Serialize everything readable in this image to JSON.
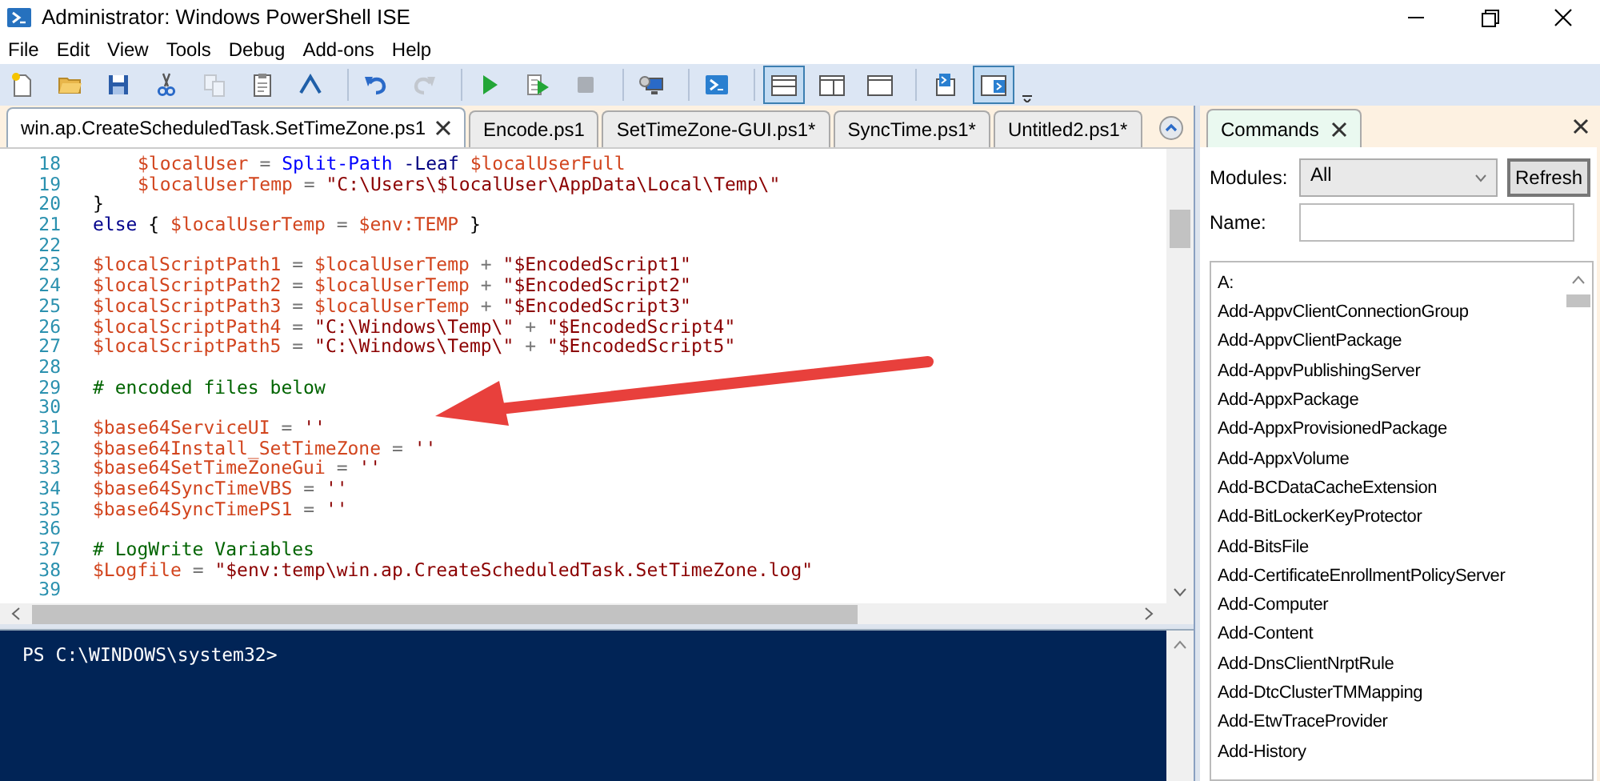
{
  "window": {
    "title": "Administrator: Windows PowerShell ISE"
  },
  "menu": [
    "File",
    "Edit",
    "View",
    "Tools",
    "Debug",
    "Add-ons",
    "Help"
  ],
  "toolbar": [
    {
      "kind": "new",
      "pressed": false,
      "disabled": false
    },
    {
      "kind": "open",
      "pressed": false,
      "disabled": false
    },
    {
      "kind": "save",
      "pressed": false,
      "disabled": false
    },
    {
      "kind": "cut",
      "pressed": false,
      "disabled": false
    },
    {
      "kind": "copy",
      "pressed": false,
      "disabled": true
    },
    {
      "kind": "paste",
      "pressed": false,
      "disabled": false
    },
    {
      "kind": "clear",
      "pressed": false,
      "disabled": false
    },
    {
      "kind": "separator"
    },
    {
      "kind": "undo",
      "pressed": false,
      "disabled": false
    },
    {
      "kind": "redo",
      "pressed": false,
      "disabled": true
    },
    {
      "kind": "separator"
    },
    {
      "kind": "run",
      "pressed": false,
      "disabled": false
    },
    {
      "kind": "runselection",
      "pressed": false,
      "disabled": false
    },
    {
      "kind": "stop",
      "pressed": false,
      "disabled": true
    },
    {
      "kind": "separator"
    },
    {
      "kind": "remote",
      "pressed": false,
      "disabled": false
    },
    {
      "kind": "separator"
    },
    {
      "kind": "console",
      "pressed": false,
      "disabled": false
    },
    {
      "kind": "separator"
    },
    {
      "kind": "layouttop",
      "pressed": true,
      "disabled": false
    },
    {
      "kind": "layoutright",
      "pressed": false,
      "disabled": false
    },
    {
      "kind": "layoutmax",
      "pressed": false,
      "disabled": false
    },
    {
      "kind": "separator"
    },
    {
      "kind": "scriptpane",
      "pressed": false,
      "disabled": false
    },
    {
      "kind": "commandpane",
      "pressed": true,
      "disabled": false
    }
  ],
  "tabs": [
    {
      "label": "win.ap.CreateScheduledTask.SetTimeZone.ps1",
      "selected": true
    },
    {
      "label": "Encode.ps1",
      "selected": false
    },
    {
      "label": "SetTimeZone-GUI.ps1*",
      "selected": false
    },
    {
      "label": "SyncTime.ps1*",
      "selected": false
    },
    {
      "label": "Untitled2.ps1*",
      "selected": false
    }
  ],
  "editor": {
    "lines": [
      {
        "number": "18",
        "indented": true,
        "tokens": [
          {
            "kind": "variable",
            "text": "$localUser"
          },
          {
            "kind": "operator",
            "text": "="
          },
          {
            "kind": "command",
            "text": "Split-Path"
          },
          {
            "kind": "parameter",
            "text": "-Leaf"
          },
          {
            "kind": "variable",
            "text": "$localUserFull"
          }
        ]
      },
      {
        "number": "19",
        "indented": true,
        "tokens": [
          {
            "kind": "variable",
            "text": "$localUserTemp"
          },
          {
            "kind": "operator",
            "text": "="
          },
          {
            "kind": "string",
            "text": "\"C:\\Users\\$localUser\\AppData\\Local\\Temp\\\""
          }
        ]
      },
      {
        "number": "20",
        "indented": false,
        "tokens": [
          {
            "kind": "plain",
            "text": "}"
          }
        ]
      },
      {
        "number": "21",
        "indented": false,
        "tokens": [
          {
            "kind": "keyword",
            "text": "else"
          },
          {
            "kind": "plain",
            "text": "{"
          },
          {
            "kind": "variable",
            "text": "$localUserTemp"
          },
          {
            "kind": "operator",
            "text": "="
          },
          {
            "kind": "variable",
            "text": "$env:TEMP"
          },
          {
            "kind": "plain",
            "text": "}"
          }
        ]
      },
      {
        "number": "22"
      },
      {
        "number": "23",
        "indented": false,
        "tokens": [
          {
            "kind": "variable",
            "text": "$localScriptPath1"
          },
          {
            "kind": "operator",
            "text": "="
          },
          {
            "kind": "variable",
            "text": "$localUserTemp"
          },
          {
            "kind": "operator",
            "text": "+"
          },
          {
            "kind": "string",
            "text": "\"$EncodedScript1\""
          }
        ]
      },
      {
        "number": "24",
        "indented": false,
        "tokens": [
          {
            "kind": "variable",
            "text": "$localScriptPath2"
          },
          {
            "kind": "operator",
            "text": "="
          },
          {
            "kind": "variable",
            "text": "$localUserTemp"
          },
          {
            "kind": "operator",
            "text": "+"
          },
          {
            "kind": "string",
            "text": "\"$EncodedScript2\""
          }
        ]
      },
      {
        "number": "25",
        "indented": false,
        "tokens": [
          {
            "kind": "variable",
            "text": "$localScriptPath3"
          },
          {
            "kind": "operator",
            "text": "="
          },
          {
            "kind": "variable",
            "text": "$localUserTemp"
          },
          {
            "kind": "operator",
            "text": "+"
          },
          {
            "kind": "string",
            "text": "\"$EncodedScript3\""
          }
        ]
      },
      {
        "number": "26",
        "indented": false,
        "tokens": [
          {
            "kind": "variable",
            "text": "$localScriptPath4"
          },
          {
            "kind": "operator",
            "text": "="
          },
          {
            "kind": "string",
            "text": "\"C:\\Windows\\Temp\\\""
          },
          {
            "kind": "operator",
            "text": "+"
          },
          {
            "kind": "string",
            "text": "\"$EncodedScript4\""
          }
        ]
      },
      {
        "number": "27",
        "indented": false,
        "tokens": [
          {
            "kind": "variable",
            "text": "$localScriptPath5"
          },
          {
            "kind": "operator",
            "text": "="
          },
          {
            "kind": "string",
            "text": "\"C:\\Windows\\Temp\\\""
          },
          {
            "kind": "operator",
            "text": "+"
          },
          {
            "kind": "string",
            "text": "\"$EncodedScript5\""
          }
        ]
      },
      {
        "number": "28"
      },
      {
        "number": "29",
        "indented": false,
        "tokens": [
          {
            "kind": "comment",
            "text": "# encoded files below"
          }
        ]
      },
      {
        "number": "30"
      },
      {
        "number": "31",
        "indented": false,
        "tokens": [
          {
            "kind": "variable",
            "text": "$base64ServiceUI"
          },
          {
            "kind": "operator",
            "text": "="
          },
          {
            "kind": "string",
            "text": "''"
          }
        ]
      },
      {
        "number": "32",
        "indented": false,
        "tokens": [
          {
            "kind": "variable",
            "text": "$base64Install_SetTimeZone"
          },
          {
            "kind": "operator",
            "text": "="
          },
          {
            "kind": "string",
            "text": "''"
          }
        ]
      },
      {
        "number": "33",
        "indented": false,
        "tokens": [
          {
            "kind": "variable",
            "text": "$base64SetTimeZoneGui"
          },
          {
            "kind": "operator",
            "text": "="
          },
          {
            "kind": "string",
            "text": "''"
          }
        ]
      },
      {
        "number": "34",
        "indented": false,
        "tokens": [
          {
            "kind": "variable",
            "text": "$base64SyncTimeVBS"
          },
          {
            "kind": "operator",
            "text": "="
          },
          {
            "kind": "string",
            "text": "''"
          }
        ]
      },
      {
        "number": "35",
        "indented": false,
        "tokens": [
          {
            "kind": "variable",
            "text": "$base64SyncTimePS1"
          },
          {
            "kind": "operator",
            "text": "="
          },
          {
            "kind": "string",
            "text": "''"
          }
        ]
      },
      {
        "number": "36"
      },
      {
        "number": "37",
        "indented": false,
        "tokens": [
          {
            "kind": "comment",
            "text": "# LogWrite Variables"
          }
        ]
      },
      {
        "number": "38",
        "indented": false,
        "tokens": [
          {
            "kind": "variable",
            "text": "$Logfile"
          },
          {
            "kind": "operator",
            "text": "="
          },
          {
            "kind": "string",
            "text": "\"$env:temp\\win.ap.CreateScheduledTask.SetTimeZone.log\""
          }
        ]
      },
      {
        "number": "39"
      }
    ]
  },
  "console": {
    "prompt": "PS C:\\WINDOWS\\system32>"
  },
  "commands_pane": {
    "tab": "Commands",
    "modules_label": "Modules:",
    "modules_value": "All",
    "refresh": "Refresh",
    "name_label": "Name:",
    "items": [
      "A:",
      "Add-AppvClientConnectionGroup",
      "Add-AppvClientPackage",
      "Add-AppvPublishingServer",
      "Add-AppxPackage",
      "Add-AppxProvisionedPackage",
      "Add-AppxVolume",
      "Add-BCDataCacheExtension",
      "Add-BitLockerKeyProtector",
      "Add-BitsFile",
      "Add-CertificateEnrollmentPolicyServer",
      "Add-Computer",
      "Add-Content",
      "Add-DnsClientNrptRule",
      "Add-DtcClusterTMMapping",
      "Add-EtwTraceProvider",
      "Add-History"
    ]
  }
}
